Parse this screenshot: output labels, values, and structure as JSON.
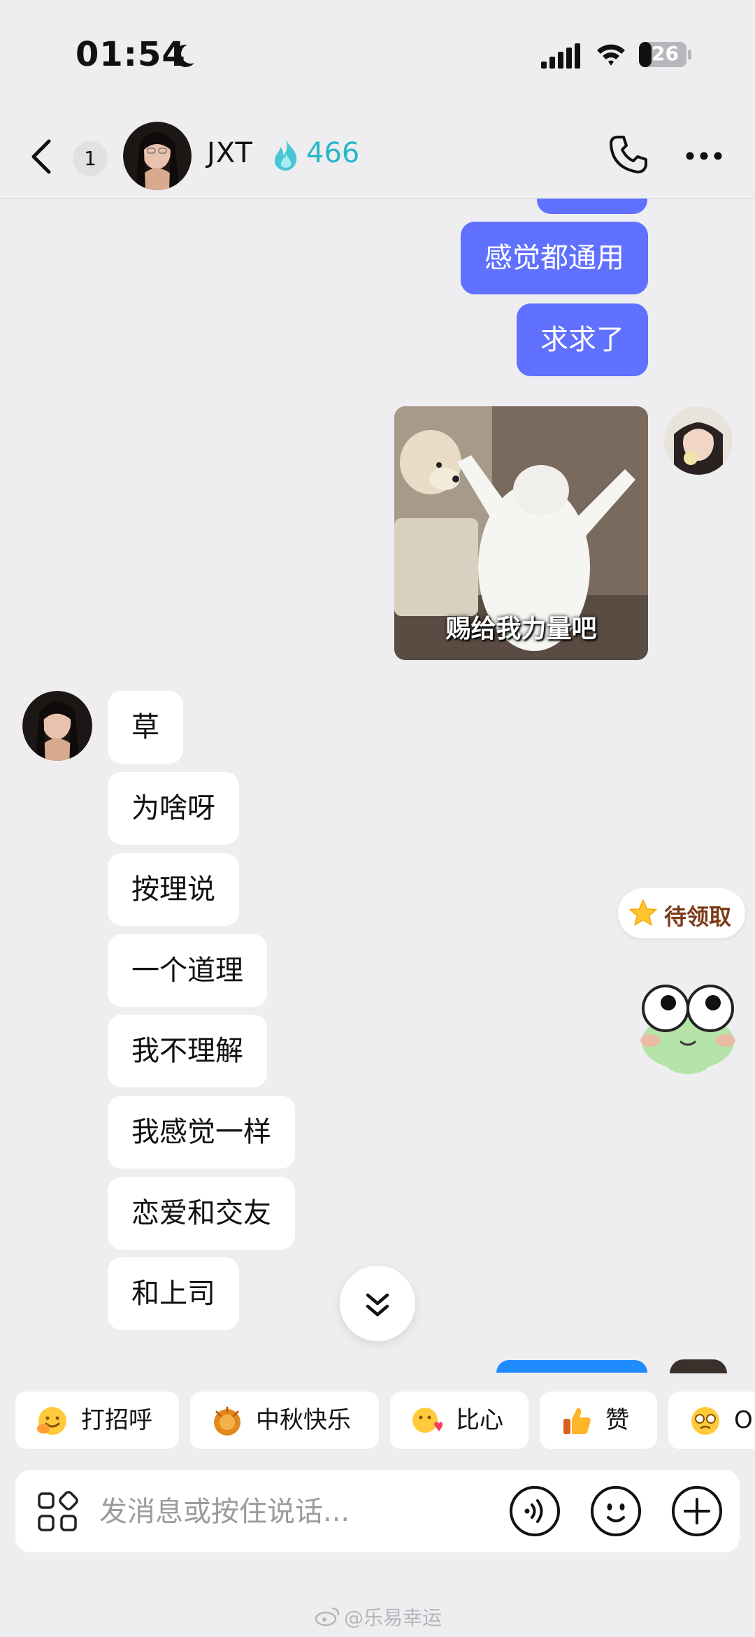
{
  "status_bar": {
    "time": "01:54",
    "battery": "26"
  },
  "header": {
    "unread_count": "1",
    "contact_name": "JXT",
    "streak": "466"
  },
  "messages_sent": [
    {
      "text": "感觉都通用"
    },
    {
      "text": "求求了"
    }
  ],
  "sent_image": {
    "caption": "赐给我力量吧"
  },
  "messages_received": [
    {
      "text": "草"
    },
    {
      "text": "为啥呀"
    },
    {
      "text": "按理说"
    },
    {
      "text": "一个道理"
    },
    {
      "text": "我不理解"
    },
    {
      "text": "我感觉一样"
    },
    {
      "text": "恋爱和交友"
    },
    {
      "text": "和上司"
    }
  ],
  "reward": {
    "label": "待领取"
  },
  "quick_replies": [
    {
      "label": "打招呼",
      "icon": "wave-emoji"
    },
    {
      "label": "中秋快乐",
      "icon": "mooncake-emoji"
    },
    {
      "label": "比心",
      "icon": "finger-heart-emoji"
    },
    {
      "label": "赞",
      "icon": "thumbs-up-emoji"
    },
    {
      "label": "O",
      "icon": "pleading-emoji"
    }
  ],
  "input": {
    "placeholder": "发消息或按住说话..."
  },
  "watermark": "@乐易幸运",
  "colors": {
    "background": "#eeeef1",
    "my_bubble": "#6070ff",
    "their_bubble": "#ffffff",
    "streak": "#28b7c9"
  }
}
